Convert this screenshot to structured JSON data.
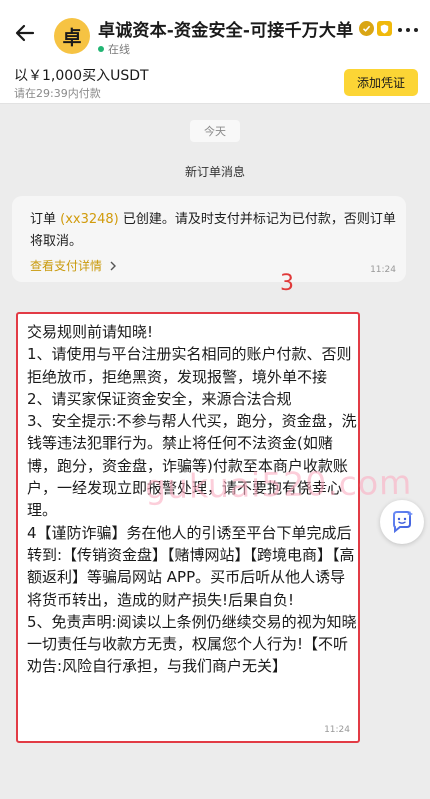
{
  "header": {
    "back_icon": "back-arrow-icon",
    "avatar_text": "卓",
    "title": "卓诚资本-资金安全-可接千万大单",
    "status": "在线",
    "status_color": "#22b573",
    "badges": [
      "verified-icon",
      "shield-badge-icon"
    ],
    "more_icon": "more-dots-icon"
  },
  "order_bar": {
    "summary": "以￥1,000买入USDT",
    "deadline": "请在29:39内付款",
    "add_proof_label": "添加凭证",
    "accent_color": "#fcd535"
  },
  "chat": {
    "date_label": "今天",
    "system_title": "新订单消息",
    "system_card": {
      "text_prefix": "订单 ",
      "order_id": "(xx3248)",
      "text_suffix": " 已创建。请及时支付并标记为已付款，否则订单将取消。",
      "link_label": "查看支付详情",
      "time": "11:24"
    },
    "annotation": "3",
    "message": {
      "text": "交易规则前请知晓!\n1、请使用与平台注册实名相同的账户付款、否则拒绝放币，拒绝黑资，发现报警，境外单不接\n2、请买家保证资金安全，来源合法合规\n3、安全提示:不参与帮人代买，跑分，资金盘，洗钱等违法犯罪行为。禁止将任何不法资金(如赌博，跑分，资金盘，诈骗等)付款至本商户收款账户，一经发现立即报警处理，请不要抱有侥幸心理。\n4【谨防诈骗】务在他人的引诱至平台下单完成后转到:【传销资金盘】【赌博网站】【跨境电商】【高额返利】等骗局网站 APP。买币后听从他人诱导将货币转出，造成的财产损失!后果自负!\n5、免责声明:阅读以上条例仍继续交易的视为知晓一切责任与收款方无责，权属您个人行为!【不听劝告:风险自行承担，与我们商户无关】",
      "time": "11:24",
      "highlight_color": "#e23b45"
    },
    "watermark": "gukuai520.com",
    "assistant_icon": "ai-assistant-icon"
  }
}
